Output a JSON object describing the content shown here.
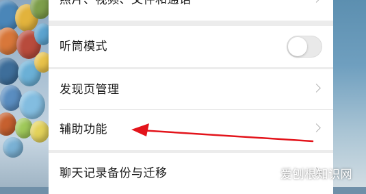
{
  "settings": {
    "rows": [
      {
        "label": "照片、视频、文件和通话",
        "type": "chevron"
      },
      {
        "label": "听筒模式",
        "type": "toggle",
        "on": false
      },
      {
        "label": "发现页管理",
        "type": "chevron"
      },
      {
        "label": "辅助功能",
        "type": "chevron"
      },
      {
        "label": "聊天记录备份与迁移",
        "type": "chevron"
      }
    ]
  },
  "annotation": {
    "color": "#e3141b",
    "target": "辅助功能"
  },
  "watermark": {
    "text": "爱刨根知识网"
  }
}
